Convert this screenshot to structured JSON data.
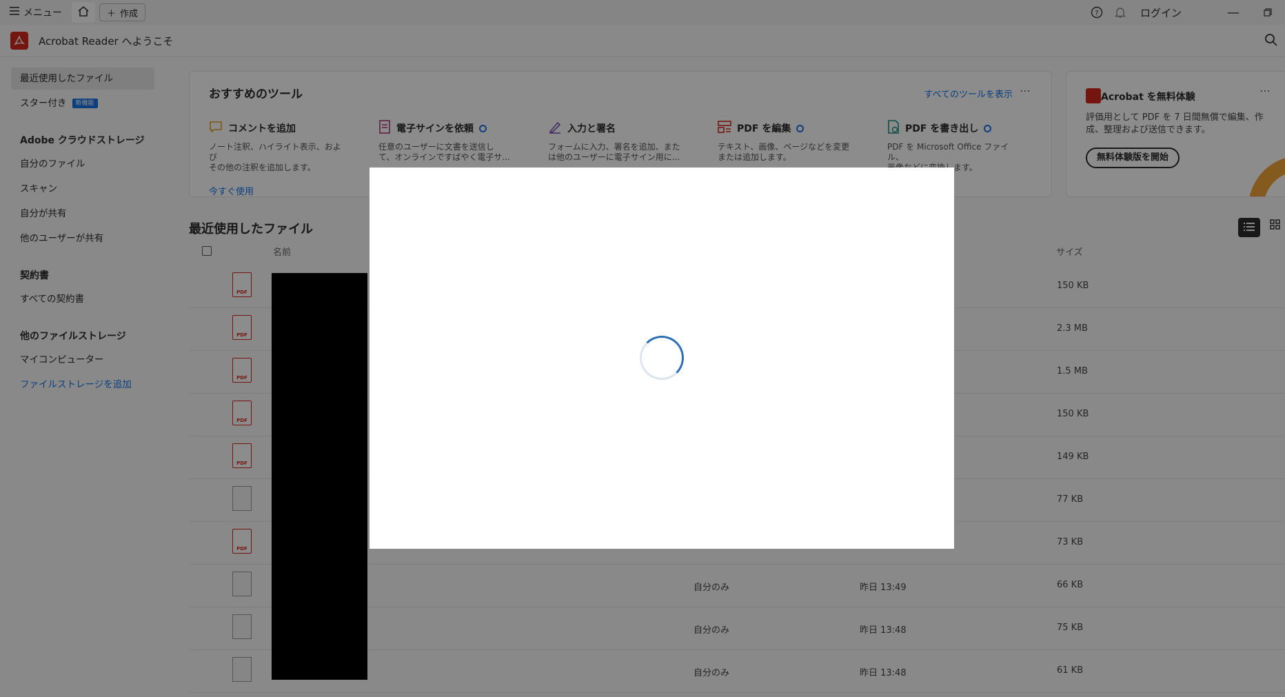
{
  "titlebar": {
    "menu_label": "メニュー",
    "create_label": "作成",
    "login_label": "ログイン"
  },
  "appbar": {
    "title": "Acrobat Reader へようこそ"
  },
  "sidebar": {
    "recent": "最近使用したファイル",
    "starred": "スター付き",
    "starred_badge": "新機能",
    "cloud_heading": "Adobe クラウドストレージ",
    "my_files": "自分のファイル",
    "scan": "スキャン",
    "shared_by_me": "自分が共有",
    "shared_by_others": "他のユーザーが共有",
    "agreements_heading": "契約書",
    "all_agreements": "すべての契約書",
    "other_storage_heading": "他のファイルストレージ",
    "my_computer": "マイコンピューター",
    "add_storage": "ファイルストレージを追加"
  },
  "tools": {
    "heading": "おすすめのツール",
    "show_all": "すべてのツールを表示",
    "items": [
      {
        "title": "コメントを追加",
        "desc1": "ノート注釈、ハイライト表示、および",
        "desc2": "その他の注釈を追加します。",
        "use": "今すぐ使用"
      },
      {
        "title": "電子サインを依頼",
        "desc1": "任意のユーザーに文書を送信し",
        "desc2": "て、オンラインですばやく電子サ..."
      },
      {
        "title": "入力と署名",
        "desc1": "フォームに入力、署名を追加、また",
        "desc2": "は他のユーザーに電子サイン用に..."
      },
      {
        "title": "PDF を編集",
        "desc1": "テキスト、画像、ページなどを変更",
        "desc2": "または追加します。"
      },
      {
        "title": "PDF を書き出し",
        "desc1": "PDF を Microsoft Office ファイル、",
        "desc2": "画像などに変換します。"
      }
    ]
  },
  "trial": {
    "heading": "Acrobat を無料体験",
    "desc": "評価用として PDF を 7 日間無償で編集、作成、整理および送信できます。",
    "button": "無料体験版を開始"
  },
  "recent": {
    "title": "最近使用したファイル",
    "columns": {
      "name": "名前",
      "size": "サイズ"
    },
    "rows": [
      {
        "type": "pdf",
        "sharing": "",
        "date": "",
        "size": "150 KB"
      },
      {
        "type": "pdf",
        "sharing": "",
        "date": "",
        "size": "2.3 MB"
      },
      {
        "type": "pdf",
        "sharing": "",
        "date": "",
        "size": "1.5 MB"
      },
      {
        "type": "pdf",
        "sharing": "",
        "date": "",
        "size": "150 KB"
      },
      {
        "type": "pdf",
        "sharing": "",
        "date": "",
        "size": "149 KB"
      },
      {
        "type": "doc",
        "sharing": "",
        "date": "",
        "size": "77 KB"
      },
      {
        "type": "pdf",
        "sharing": "",
        "date": "",
        "size": "73 KB"
      },
      {
        "type": "doc",
        "sharing": "自分のみ",
        "date": "昨日 13:49",
        "size": "66 KB"
      },
      {
        "type": "doc",
        "sharing": "自分のみ",
        "date": "昨日 13:48",
        "size": "75 KB"
      },
      {
        "type": "doc",
        "sharing": "自分のみ",
        "date": "昨日 13:48",
        "size": "61 KB"
      }
    ]
  },
  "colors": {
    "accent": "#1473e6",
    "brand_red": "#d4281c",
    "spinner": "#2d6fb4"
  }
}
